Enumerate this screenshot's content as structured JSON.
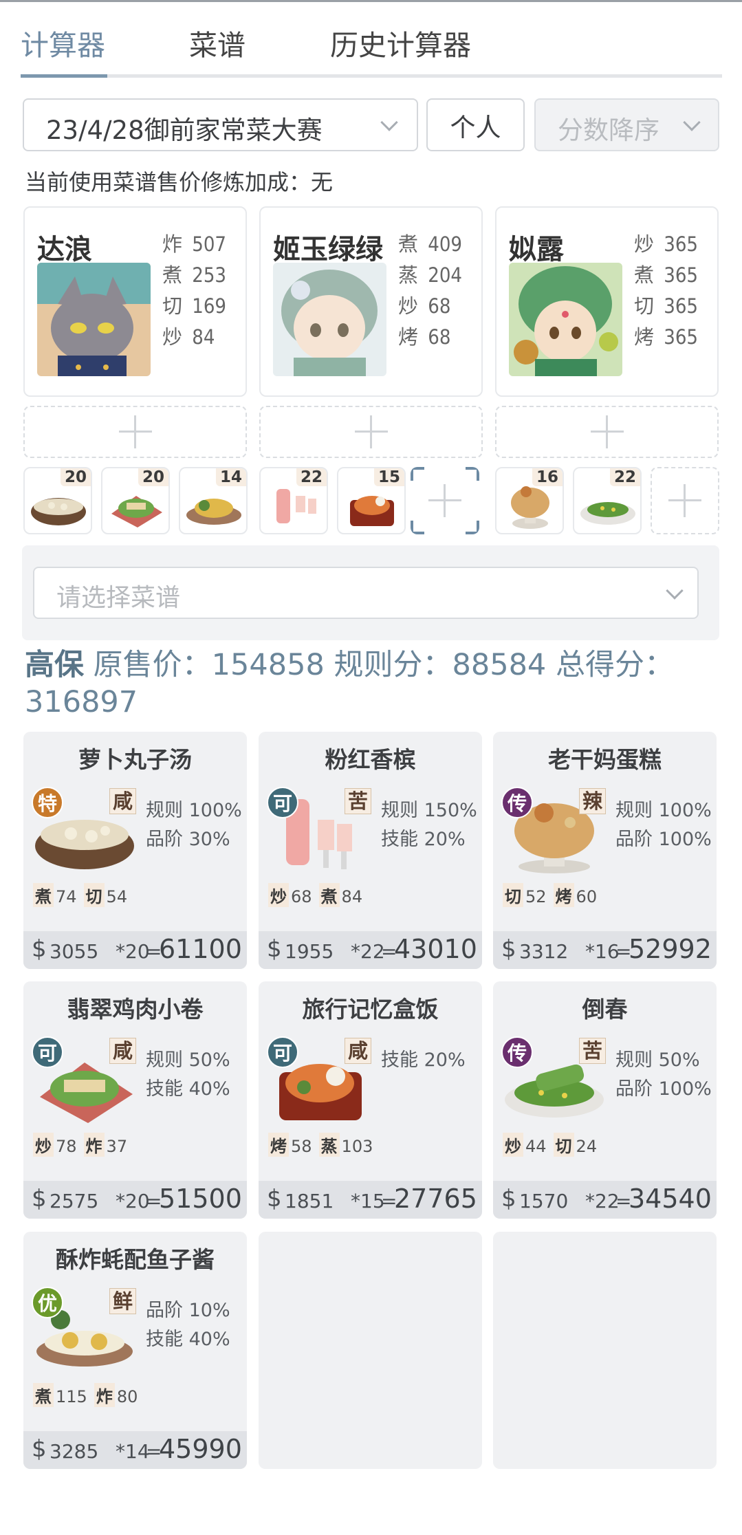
{
  "tabs": [
    "计算器",
    "菜谱",
    "历史计算器"
  ],
  "filters": {
    "contest": "23/4/28御前家常菜大赛",
    "mode": "个人",
    "sort": "分数降序"
  },
  "bonus_text": "当前使用菜谱售价修炼加成：无",
  "chefs": [
    {
      "name": "达浪",
      "skills": [
        [
          "炸",
          "507"
        ],
        [
          "煮",
          "253"
        ],
        [
          "切",
          "169"
        ],
        [
          "炒",
          "84"
        ]
      ]
    },
    {
      "name": "姬玉绿绿",
      "skills": [
        [
          "煮",
          "409"
        ],
        [
          "蒸",
          "204"
        ],
        [
          "炒",
          "68"
        ],
        [
          "烤",
          "68"
        ]
      ]
    },
    {
      "name": "姒露",
      "skills": [
        [
          "炒",
          "365"
        ],
        [
          "煮",
          "365"
        ],
        [
          "切",
          "365"
        ],
        [
          "烤",
          "365"
        ]
      ]
    }
  ],
  "dish_counts": [
    "20",
    "20",
    "14",
    "22",
    "15",
    "",
    "16",
    "22",
    ""
  ],
  "recipe_placeholder": "请选择菜谱",
  "summary": {
    "level": "高保",
    "orig_label": "原售价：",
    "orig": "154858",
    "rule_label": "规则分：",
    "rule": "88584",
    "total_label": "总得分：",
    "total": "316897"
  },
  "recipes": [
    {
      "name": "萝卜丸子汤",
      "grade": "特",
      "taste": "咸",
      "bonus": [
        "规则 100%",
        "品阶 30%"
      ],
      "tags": [
        [
          "煮",
          "74"
        ],
        [
          "切",
          "54"
        ]
      ],
      "price": "3055",
      "mult": "*20",
      "total": "61100"
    },
    {
      "name": "粉红香槟",
      "grade": "可",
      "taste": "苦",
      "bonus": [
        "规则 150%",
        "技能 20%"
      ],
      "tags": [
        [
          "炒",
          "68"
        ],
        [
          "煮",
          "84"
        ]
      ],
      "price": "1955",
      "mult": "*22",
      "total": "43010"
    },
    {
      "name": "老干妈蛋糕",
      "grade": "传",
      "taste": "辣",
      "bonus": [
        "规则 100%",
        "品阶 100%"
      ],
      "tags": [
        [
          "切",
          "52"
        ],
        [
          "烤",
          "60"
        ]
      ],
      "price": "3312",
      "mult": "*16",
      "total": "52992"
    },
    {
      "name": "翡翠鸡肉小卷",
      "grade": "可",
      "taste": "咸",
      "bonus": [
        "规则 50%",
        "技能 40%"
      ],
      "tags": [
        [
          "炒",
          "78"
        ],
        [
          "炸",
          "37"
        ]
      ],
      "price": "2575",
      "mult": "*20",
      "total": "51500"
    },
    {
      "name": "旅行记忆盒饭",
      "grade": "可",
      "taste": "咸",
      "bonus": [
        "技能 20%"
      ],
      "tags": [
        [
          "烤",
          "58"
        ],
        [
          "蒸",
          "103"
        ]
      ],
      "price": "1851",
      "mult": "*15",
      "total": "27765"
    },
    {
      "name": "倒春",
      "grade": "传",
      "taste": "苦",
      "bonus": [
        "规则 50%",
        "品阶 100%"
      ],
      "tags": [
        [
          "炒",
          "44"
        ],
        [
          "切",
          "24"
        ]
      ],
      "price": "1570",
      "mult": "*22",
      "total": "34540"
    },
    {
      "name": "酥炸蚝配鱼子酱",
      "grade": "优",
      "taste": "鲜",
      "bonus": [
        "品阶 10%",
        "技能 40%"
      ],
      "tags": [
        [
          "煮",
          "115"
        ],
        [
          "炸",
          "80"
        ]
      ],
      "price": "3285",
      "mult": "*14",
      "total": "45990"
    }
  ],
  "colors": {
    "accent": "#7d98ae",
    "grade_特": "#c8792a",
    "grade_可": "#3f6a78",
    "grade_传": "#6a2f6e",
    "grade_优": "#6b9a2a"
  }
}
